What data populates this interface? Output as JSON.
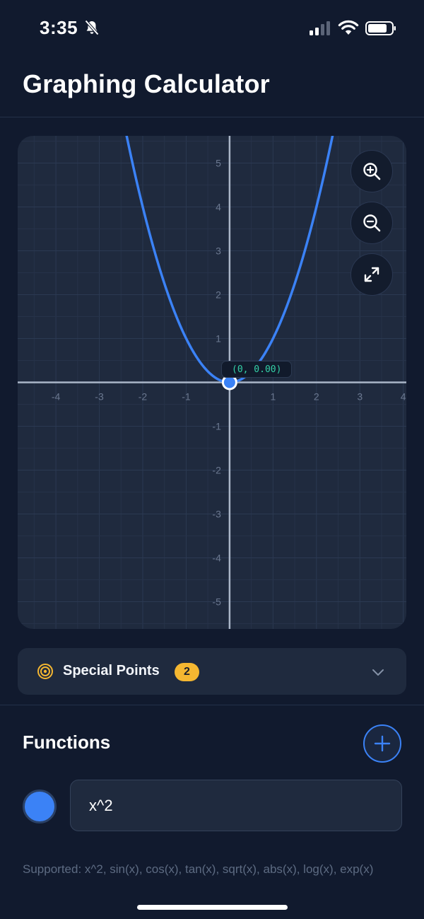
{
  "status_bar": {
    "time": "3:35"
  },
  "header": {
    "title": "Graphing Calculator"
  },
  "graph": {
    "x_ticks": [
      -4,
      -3,
      -2,
      -1,
      1,
      2,
      3,
      4
    ],
    "y_ticks": [
      5,
      4,
      3,
      2,
      1,
      -1,
      -2,
      -3,
      -4,
      -5
    ],
    "x_range": [
      -4.88,
      4.07
    ],
    "y_range": [
      -5.62,
      5.62
    ],
    "point_label": "(0, 0.00)",
    "point": {
      "x": 0,
      "y": 0
    },
    "curve_color": "#3b82f6",
    "controls": [
      "zoom-in",
      "zoom-out",
      "fit-view"
    ]
  },
  "special_points": {
    "label": "Special Points",
    "count": "2"
  },
  "functions": {
    "title": "Functions",
    "items": [
      {
        "expression": "x^2",
        "color": "#3b82f6"
      }
    ],
    "supported_text": "Supported: x^2, sin(x), cos(x), tan(x), sqrt(x), abs(x), log(x), exp(x)"
  }
}
